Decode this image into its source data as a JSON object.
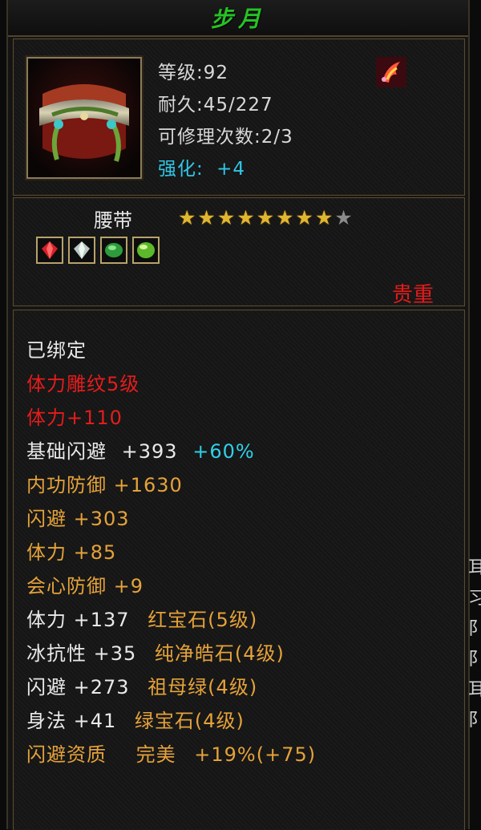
{
  "item": {
    "name": "步月",
    "level_text": "等级:92",
    "durability_text": "耐久:45/227",
    "repair_text": "可修理次数:2/3",
    "enhance_label": "强化:",
    "enhance_value": "+4",
    "type": "腰带",
    "stars_filled": 8,
    "stars_total": 9,
    "rarity": "贵重",
    "gems": [
      "red-gem-icon",
      "white-gem-icon",
      "green-gem-icon",
      "emerald-gem-icon"
    ]
  },
  "attributes": {
    "bound": "已绑定",
    "carving": "体力雕纹5级",
    "carving_bonus": "体力+110",
    "base_dodge": {
      "label": "基础闪避",
      "value": "+393",
      "percent": "+60%"
    },
    "inner_defense": "内功防御 +1630",
    "dodge": "闪避 +303",
    "stamina": "体力 +85",
    "crit_defense": "会心防御 +9",
    "gem_lines": [
      {
        "stat": "体力 +137",
        "gem": "红宝石(5级)"
      },
      {
        "stat": "冰抗性 +35",
        "gem": "纯净皓石(4级)"
      },
      {
        "stat": "闪避 +273",
        "gem": "祖母绿(4级)"
      },
      {
        "stat": "身法 +41",
        "gem": "绿宝石(4级)"
      }
    ],
    "quality": {
      "label": "闪避资质",
      "grade": "完美",
      "bonus": "+19%(+75)"
    }
  },
  "edge_chars": [
    "耳",
    "习",
    "阝",
    "阝",
    "耳",
    "阝"
  ],
  "colors": {
    "title_green": "#26c224",
    "rarity_red": "#e31b1b",
    "cyan": "#30d0e8",
    "orange": "#e5a23a",
    "star_gold": "#e0b530"
  }
}
